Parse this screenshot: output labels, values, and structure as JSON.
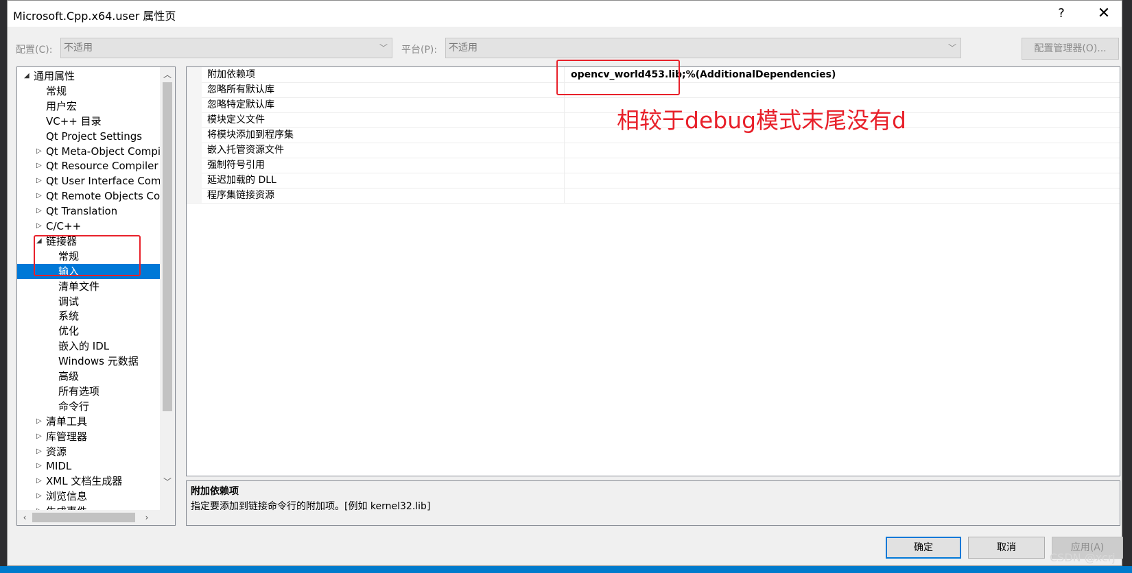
{
  "window": {
    "title": "Microsoft.Cpp.x64.user 属性页",
    "help_glyph": "?",
    "close_glyph": "✕"
  },
  "config_bar": {
    "config_label": "配置(C):",
    "config_value": "不适用",
    "platform_label": "平台(P):",
    "platform_value": "不适用",
    "config_manager_label": "配置管理器(O)..."
  },
  "tree": {
    "items": [
      {
        "label": "通用属性",
        "arrow": "◢"
      },
      {
        "label": "常规",
        "arrow": ""
      },
      {
        "label": "用户宏",
        "arrow": ""
      },
      {
        "label": "VC++ 目录",
        "arrow": ""
      },
      {
        "label": "Qt Project Settings",
        "arrow": ""
      },
      {
        "label": "Qt Meta-Object Compiler",
        "arrow": "▷"
      },
      {
        "label": "Qt Resource Compiler",
        "arrow": "▷"
      },
      {
        "label": "Qt User Interface Compiler",
        "arrow": "▷"
      },
      {
        "label": "Qt Remote Objects Compiler",
        "arrow": "▷"
      },
      {
        "label": "Qt Translation",
        "arrow": "▷"
      },
      {
        "label": "C/C++",
        "arrow": "▷"
      },
      {
        "label": "链接器",
        "arrow": "◢"
      },
      {
        "label": "常规",
        "arrow": ""
      },
      {
        "label": "输入",
        "arrow": ""
      },
      {
        "label": "清单文件",
        "arrow": ""
      },
      {
        "label": "调试",
        "arrow": ""
      },
      {
        "label": "系统",
        "arrow": ""
      },
      {
        "label": "优化",
        "arrow": ""
      },
      {
        "label": "嵌入的 IDL",
        "arrow": ""
      },
      {
        "label": "Windows 元数据",
        "arrow": ""
      },
      {
        "label": "高级",
        "arrow": ""
      },
      {
        "label": "所有选项",
        "arrow": ""
      },
      {
        "label": "命令行",
        "arrow": ""
      },
      {
        "label": "清单工具",
        "arrow": "▷"
      },
      {
        "label": "库管理器",
        "arrow": "▷"
      },
      {
        "label": "资源",
        "arrow": "▷"
      },
      {
        "label": "MIDL",
        "arrow": "▷"
      },
      {
        "label": "XML 文档生成器",
        "arrow": "▷"
      },
      {
        "label": "浏览信息",
        "arrow": "▷"
      },
      {
        "label": "生成事件",
        "arrow": "▷"
      }
    ],
    "selected": "输入"
  },
  "properties": [
    {
      "name": "附加依赖项",
      "value": "opencv_world453.lib;%(AdditionalDependencies)"
    },
    {
      "name": "忽略所有默认库",
      "value": ""
    },
    {
      "name": "忽略特定默认库",
      "value": ""
    },
    {
      "name": "模块定义文件",
      "value": ""
    },
    {
      "name": "将模块添加到程序集",
      "value": ""
    },
    {
      "name": "嵌入托管资源文件",
      "value": ""
    },
    {
      "name": "强制符号引用",
      "value": ""
    },
    {
      "name": "延迟加载的 DLL",
      "value": ""
    },
    {
      "name": "程序集链接资源",
      "value": ""
    }
  ],
  "description": {
    "title": "附加依赖项",
    "text": "指定要添加到链接命令行的附加项。[例如 kernel32.lib]"
  },
  "buttons": {
    "ok": "确定",
    "cancel": "取消",
    "apply": "应用(A)"
  },
  "annotation": {
    "text": "相较于debug模式末尾没有d",
    "color": "#e8202a"
  },
  "watermark": "CSDN @xcrj",
  "colors": {
    "selection": "#0078d7",
    "dialog_bg": "#f0f0f0"
  }
}
